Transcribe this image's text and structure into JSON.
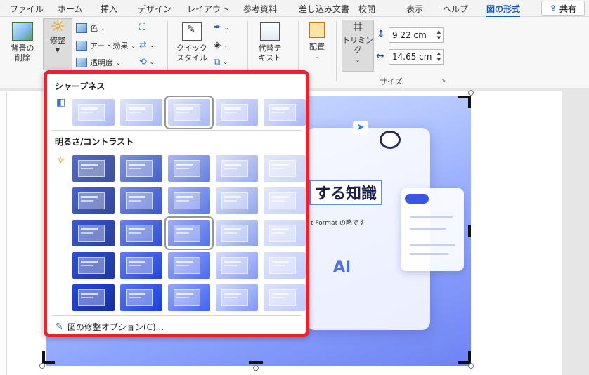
{
  "tabs": [
    "ファイル",
    "ホーム",
    "挿入",
    "デザイン",
    "レイアウト",
    "参考資料",
    "差し込み文書",
    "校閲",
    "表示",
    "ヘルプ",
    "図の形式"
  ],
  "active_tab": "図の形式",
  "share_label": "共有",
  "ribbon": {
    "remove_bg_label": "背景の\n削除",
    "corrections_label": "修整",
    "color_label": "色",
    "artistic_label": "アート効果",
    "transparency_label": "透明度",
    "quick_styles_label": "クイック\nスタイル",
    "alt_text_label": "代替テ\nキスト",
    "arrange_label": "配置",
    "crop_label": "トリミング",
    "height_value": "9.22 cm",
    "width_value": "14.65 cm",
    "size_group_label": "サイズ"
  },
  "gallery": {
    "sharpness_title": "シャープネス",
    "brightness_title": "明るさ/コントラスト",
    "options_link": "図の修整オプション(C)...",
    "sharpness_selected_index": 2,
    "brightness_selected": [
      2,
      2
    ],
    "brightness_rows": 5,
    "brightness_cols": 5
  },
  "picture": {
    "headline": "する知識",
    "subline": "t Format の略です",
    "ai_label": "AI"
  },
  "colors": {
    "accent": "#1e5aa8",
    "gallery_border": "#e8232d"
  }
}
